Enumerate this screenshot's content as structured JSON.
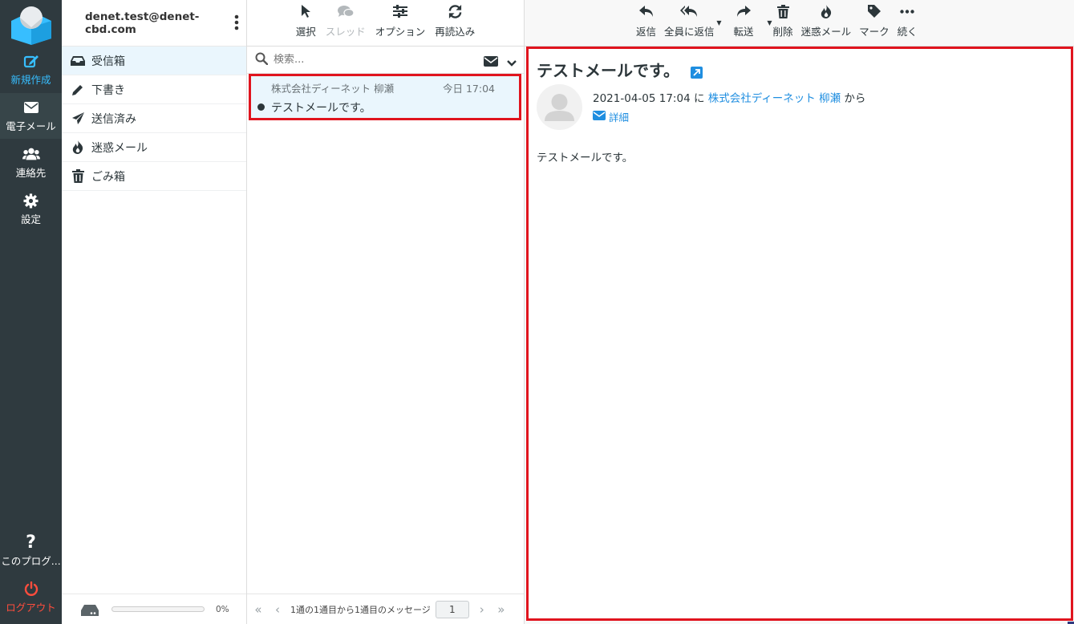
{
  "account": {
    "email": "denet.test@denet-cbd.com"
  },
  "rail": {
    "compose": "新規作成",
    "mail": "電子メール",
    "contacts": "連絡先",
    "settings": "設定",
    "about": "このプログ...",
    "logout": "ログアウト"
  },
  "folders": [
    {
      "label": "受信箱",
      "icon": "inbox-icon",
      "active": true
    },
    {
      "label": "下書き",
      "icon": "pencil-icon"
    },
    {
      "label": "送信済み",
      "icon": "paper-plane-icon"
    },
    {
      "label": "迷惑メール",
      "icon": "fire-icon"
    },
    {
      "label": "ごみ箱",
      "icon": "trash-icon"
    }
  ],
  "quota": {
    "percent_text": "0%",
    "used_fraction": 0
  },
  "list_toolbar": {
    "select": "選択",
    "threads": "スレッド",
    "options": "オプション",
    "refresh": "再読込み"
  },
  "search": {
    "placeholder": "検索..."
  },
  "messages": [
    {
      "from": "株式会社ディーネット 柳瀬",
      "date": "今日 17:04",
      "subject": "テストメールです。",
      "unread": true
    }
  ],
  "pager": {
    "info": "1通の1通目から1通目のメッセージ",
    "page": "1"
  },
  "reader_toolbar": {
    "reply": "返信",
    "reply_all": "全員に返信",
    "forward": "転送",
    "delete": "削除",
    "spam": "迷惑メール",
    "mark": "マーク",
    "more": "続く"
  },
  "message": {
    "subject": "テストメールです。",
    "date": "2021-04-05 17:04",
    "to_prefix": "に",
    "sender": "株式会社ディーネット 柳瀬",
    "from_suffix": "から",
    "details": "詳細",
    "body": "テストメールです。"
  },
  "colors": {
    "accent": "#37beff",
    "link": "#1f8ee0",
    "highlight": "#e0141e",
    "logout": "#ff4d3d",
    "rail": "#2f3a3f"
  }
}
